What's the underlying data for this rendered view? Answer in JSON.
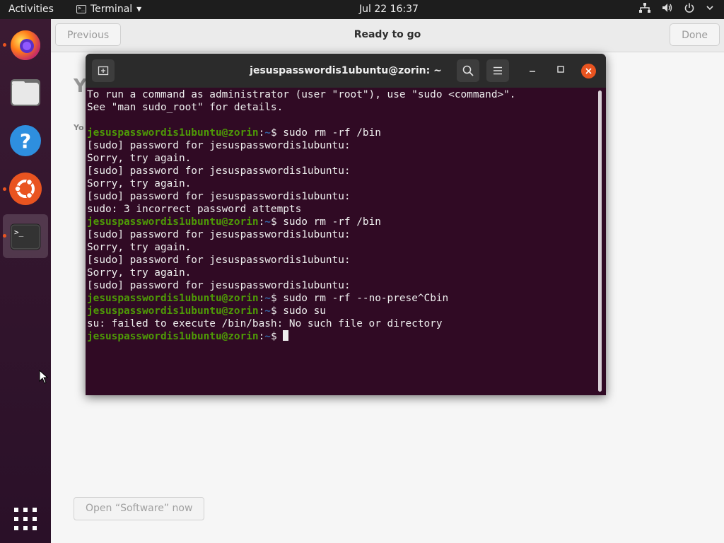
{
  "topbar": {
    "activities": "Activities",
    "app_name": "Terminal",
    "app_caret": "▾",
    "clock": "Jul 22  16:37",
    "tray_icons": [
      "network-icon",
      "volume-icon",
      "power-icon",
      "chevron-down-icon"
    ]
  },
  "dock": {
    "items": [
      "firefox-icon",
      "files-icon",
      "help-icon",
      "ubuntu-software-icon",
      "terminal-icon"
    ],
    "apps_grid": "show-applications-icon"
  },
  "background_window": {
    "previous": "Previous",
    "title": "Ready to go",
    "done": "Done",
    "ghost_heading": "Y",
    "ghost_sub": "Yo",
    "open_software": "Open “Software” now"
  },
  "terminal": {
    "title": "jesuspasswordis1ubuntu@zorin: ~",
    "user_host": "jesuspasswordis1ubuntu@zorin",
    "path": "~",
    "lines": [
      {
        "text": "To run a command as administrator (user \"root\"), use \"sudo <command>\"."
      },
      {
        "text": "See \"man sudo_root\" for details."
      },
      {
        "text": ""
      },
      {
        "prompt": true,
        "cmd": " sudo rm -rf /bin"
      },
      {
        "text": "[sudo] password for jesuspasswordis1ubuntu:"
      },
      {
        "text": "Sorry, try again."
      },
      {
        "text": "[sudo] password for jesuspasswordis1ubuntu:"
      },
      {
        "text": "Sorry, try again."
      },
      {
        "text": "[sudo] password for jesuspasswordis1ubuntu:"
      },
      {
        "text": "sudo: 3 incorrect password attempts"
      },
      {
        "prompt": true,
        "cmd": " sudo rm -rf /bin"
      },
      {
        "text": "[sudo] password for jesuspasswordis1ubuntu:"
      },
      {
        "text": "Sorry, try again."
      },
      {
        "text": "[sudo] password for jesuspasswordis1ubuntu:"
      },
      {
        "text": "Sorry, try again."
      },
      {
        "text": "[sudo] password for jesuspasswordis1ubuntu:"
      },
      {
        "prompt": true,
        "cmd": " sudo rm -rf --no-prese^Cbin"
      },
      {
        "prompt": true,
        "cmd": " sudo su"
      },
      {
        "text": "su: failed to execute /bin/bash: No such file or directory"
      },
      {
        "prompt": true,
        "cmd": " ",
        "cursor": true
      }
    ]
  }
}
